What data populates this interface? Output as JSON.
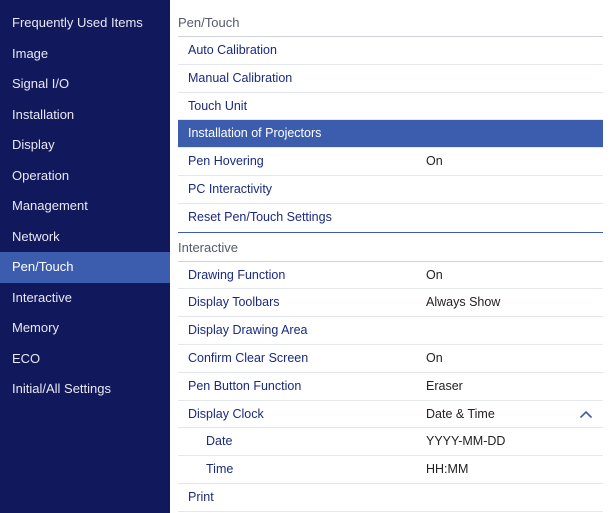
{
  "sidebar": {
    "items": [
      {
        "label": "Frequently Used Items"
      },
      {
        "label": "Image"
      },
      {
        "label": "Signal I/O"
      },
      {
        "label": "Installation"
      },
      {
        "label": "Display"
      },
      {
        "label": "Operation"
      },
      {
        "label": "Management"
      },
      {
        "label": "Network"
      },
      {
        "label": "Pen/Touch"
      },
      {
        "label": "Interactive"
      },
      {
        "label": "Memory"
      },
      {
        "label": "ECO"
      },
      {
        "label": "Initial/All Settings"
      }
    ],
    "active": "Pen/Touch"
  },
  "pen_touch": {
    "title": "Pen/Touch",
    "items": [
      {
        "label": "Auto Calibration"
      },
      {
        "label": "Manual Calibration"
      },
      {
        "label": "Touch Unit"
      },
      {
        "label": "Installation of Projectors"
      },
      {
        "label": "Pen Hovering",
        "value": "On"
      },
      {
        "label": "PC Interactivity"
      },
      {
        "label": "Reset Pen/Touch Settings"
      }
    ]
  },
  "interactive": {
    "title": "Interactive",
    "items": [
      {
        "label": "Drawing Function",
        "value": "On"
      },
      {
        "label": "Display Toolbars",
        "value": "Always Show"
      },
      {
        "label": "Display Drawing Area"
      },
      {
        "label": "Confirm Clear Screen",
        "value": "On"
      },
      {
        "label": "Pen Button Function",
        "value": "Eraser"
      },
      {
        "label": "Display Clock",
        "value": "Date & Time",
        "icon": "chevron-up-icon"
      },
      {
        "label": "Date",
        "value": "YYYY-MM-DD"
      },
      {
        "label": "Time",
        "value": "HH:MM"
      },
      {
        "label": "Print"
      }
    ]
  },
  "colors": {
    "sidebar_bg": "#12185c",
    "accent": "#3c5dad",
    "link_text": "#1a2a80"
  }
}
